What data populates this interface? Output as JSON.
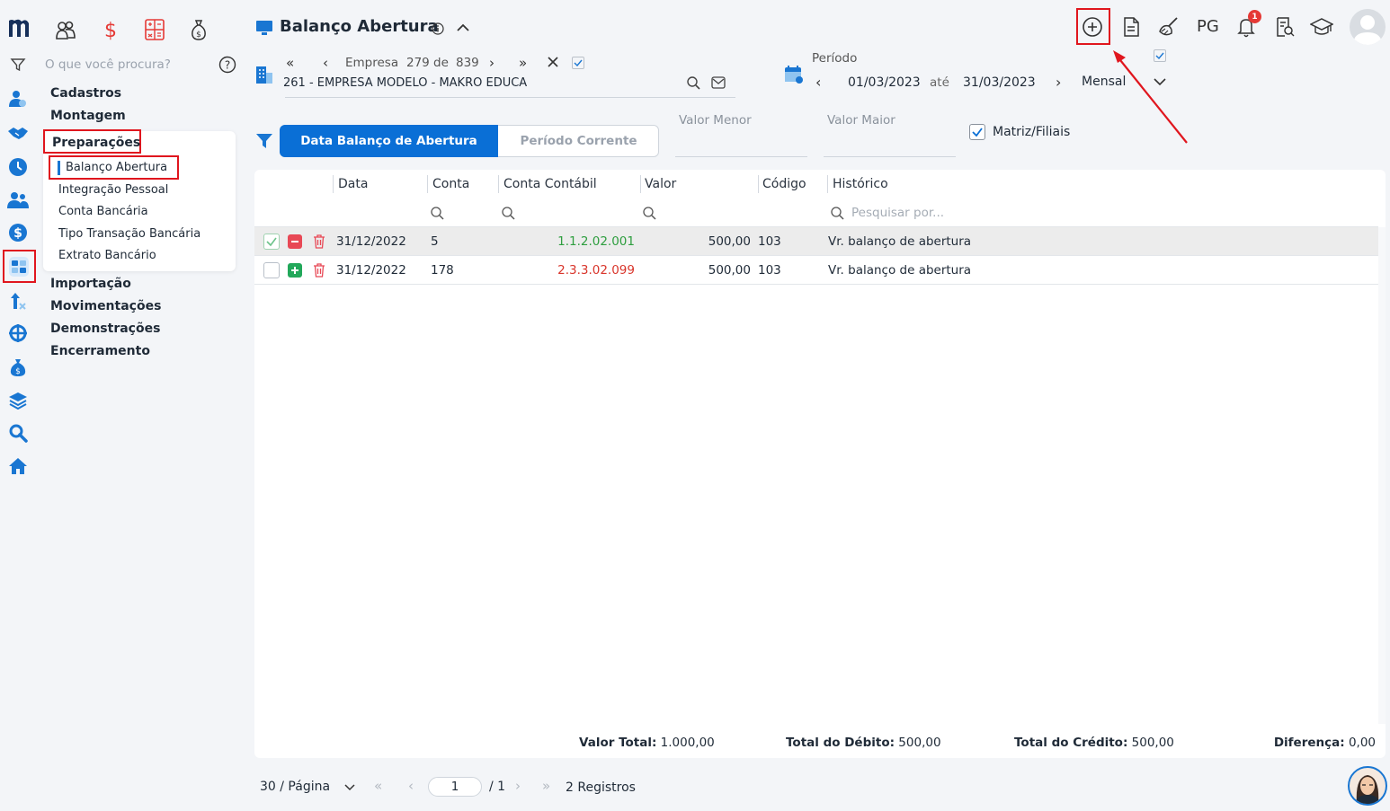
{
  "app": {
    "page_title": "Balanço Abertura"
  },
  "top_quick_icons": [
    "people-icon",
    "dollar-icon",
    "calculator-icon",
    "money-bag-icon"
  ],
  "search": {
    "placeholder": "O que você procura?"
  },
  "sidebar": {
    "menu": [
      {
        "label": "Cadastros"
      },
      {
        "label": "Montagem"
      },
      {
        "label": "Preparações"
      },
      {
        "label": "Importação"
      },
      {
        "label": "Movimentações"
      },
      {
        "label": "Demonstrações"
      },
      {
        "label": "Encerramento"
      }
    ],
    "submenu": [
      {
        "label": "Balanço Abertura"
      },
      {
        "label": "Integração Pessoal"
      },
      {
        "label": "Conta Bancária"
      },
      {
        "label": "Tipo Transação Bancária"
      },
      {
        "label": "Extrato Bancário"
      }
    ]
  },
  "header": {
    "pg_label": "PG",
    "notification_count": "1"
  },
  "company": {
    "nav_label": "Empresa",
    "current": "279",
    "of_label": "de",
    "total": "839",
    "name": "261 - EMPRESA MODELO - MAKRO EDUCA"
  },
  "period": {
    "label": "Período",
    "start": "01/03/2023",
    "until_label": "até",
    "end": "31/03/2023",
    "frequency": "Mensal"
  },
  "filters": {
    "tab_active": "Data Balanço de Abertura",
    "tab_inactive": "Período Corrente",
    "min_value_label": "Valor Menor",
    "max_value_label": "Valor Maior",
    "matriz_label": "Matriz/Filiais",
    "matriz_checked": true
  },
  "table": {
    "columns": [
      "Data",
      "Conta",
      "Conta Contábil",
      "Valor",
      "Código",
      "Histórico"
    ],
    "search_placeholder": "Pesquisar por...",
    "rows": [
      {
        "type": "debit",
        "date": "31/12/2022",
        "account": "5",
        "ledger": "1.1.2.02.001",
        "ledger_color": "#2e9e3f",
        "value": "500,00",
        "code": "103",
        "history": "Vr. balanço de abertura",
        "selected": true
      },
      {
        "type": "credit",
        "date": "31/12/2022",
        "account": "178",
        "ledger": "2.3.3.02.099",
        "ledger_color": "#d9352b",
        "value": "500,00",
        "code": "103",
        "history": "Vr. balanço de abertura",
        "selected": false
      }
    ],
    "totals": {
      "total_label": "Valor Total:",
      "total_value": "1.000,00",
      "debit_label": "Total do Débito:",
      "debit_value": "500,00",
      "credit_label": "Total do Crédito:",
      "credit_value": "500,00",
      "diff_label": "Diferença:",
      "diff_value": "0,00"
    }
  },
  "pagination": {
    "per_page": "30 / Página",
    "page": "1",
    "of_pages": "/ 1",
    "records": "2 Registros"
  },
  "colors": {
    "accent": "#0a6fd6",
    "highlight_red": "#e0161e"
  }
}
